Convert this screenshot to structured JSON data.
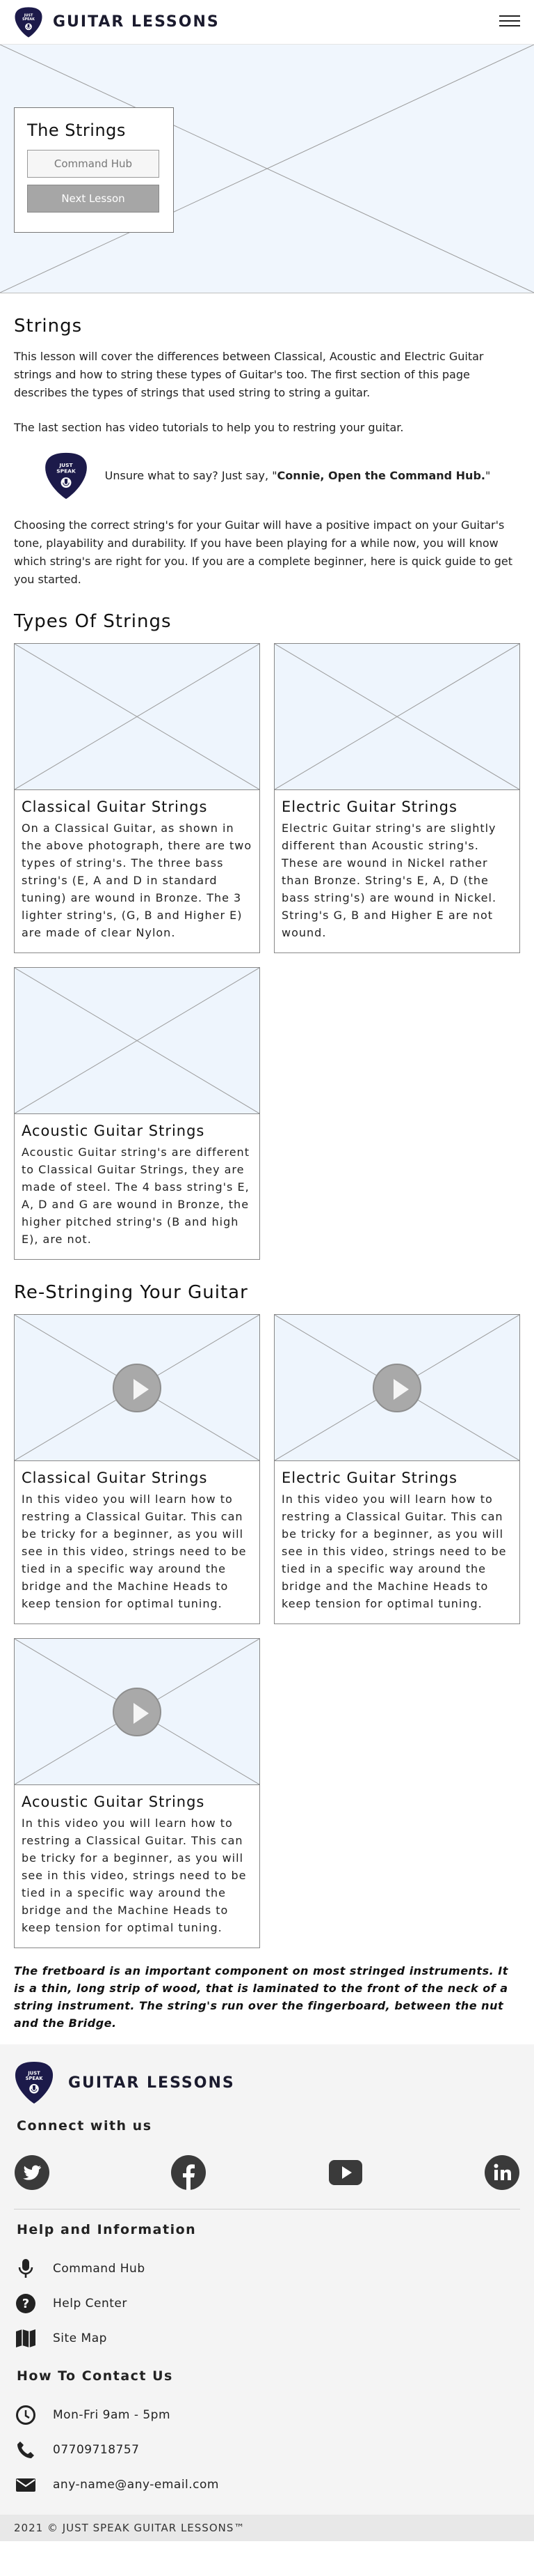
{
  "header": {
    "title": "GUITAR LESSONS",
    "logo_text_1": "JUST",
    "logo_text_2": "SPEAK"
  },
  "hero": {
    "title": "The Strings",
    "primary_button": "Command Hub",
    "secondary_button": "Next Lesson"
  },
  "intro": {
    "heading": "Strings",
    "paragraph_1": "This lesson will cover the differences between Classical, Acoustic and Electric Guitar strings and how to string these types of Guitar's too. The first section of this page describes the types of strings that used string to string a guitar.",
    "paragraph_2": "The last section has video tutorials to help you to restring your guitar.",
    "assist_prefix": "Unsure what to say? Just say, \"",
    "assist_bold": "Connie, Open the Command Hub.",
    "assist_suffix": "\"",
    "paragraph_3": "Choosing the correct string's for your Guitar will have a positive impact on your Guitar's tone, playability and durability. If you have been playing for a while now, you will know which string's are right for you. If you are a complete beginner, here is quick guide to get you started."
  },
  "types": {
    "heading": "Types Of Strings",
    "cards": [
      {
        "title": "Classical Guitar Strings",
        "text": "On a Classical Guitar, as shown in the above photograph, there are two types of string's. The three bass string's (E, A and D in standard tuning) are wound in Bronze. The 3 lighter string's, (G, B and Higher E) are made of clear Nylon."
      },
      {
        "title": "Electric Guitar Strings",
        "text": "Electric Guitar string's are slightly different than Acoustic string's. These are wound in Nickel rather than Bronze. String's E, A, D (the bass string's) are wound in Nickel. String's G, B and Higher E are not wound."
      },
      {
        "title": "Acoustic Guitar Strings",
        "text": "Acoustic Guitar string's are different to Classical Guitar Strings, they are made of steel. The 4 bass string's E, A, D and G are wound in Bronze, the higher pitched string's (B and high E), are not."
      }
    ]
  },
  "restring": {
    "heading": "Re-Stringing Your Guitar",
    "cards": [
      {
        "title": "Classical Guitar Strings",
        "text": "In this video you will learn how to restring a Classical Guitar. This can be tricky for a beginner, as you will see in this video, strings need to be tied in a specific way around the bridge and the Machine Heads to keep tension for optimal tuning."
      },
      {
        "title": "Electric Guitar Strings",
        "text": "In this video you will learn how to restring a Classical Guitar. This can be tricky for a beginner, as you will see in this video, strings need to be tied in a specific way around the bridge and the Machine Heads to keep tension for optimal tuning."
      },
      {
        "title": "Acoustic Guitar Strings",
        "text": "In this video you will learn how to restring a Classical Guitar. This can be tricky for a beginner, as you will see in this video, strings need to be tied in a specific way around the bridge and the Machine Heads to keep tension for optimal tuning."
      }
    ]
  },
  "footnote": "The fretboard is an important component on most stringed instruments. It is a thin, long strip of wood, that is laminated to the front of the neck of a string instrument. The string's run over the fingerboard, between the nut and the Bridge.",
  "footer": {
    "title": "GUITAR LESSONS",
    "connect_heading": "Connect with us",
    "social_icons": [
      "twitter-icon",
      "facebook-icon",
      "youtube-icon",
      "linkedin-icon"
    ],
    "help_heading": "Help and Information",
    "help_items": [
      "Command Hub",
      "Help Center",
      "Site Map"
    ],
    "contact_heading": "How To Contact Us",
    "contact_hours": "Mon-Fri 9am - 5pm",
    "contact_phone": "07709718757",
    "contact_email": "any-name@any-email.com",
    "copyright": "2021 © JUST SPEAK GUITAR LESSONS™"
  },
  "colors": {
    "brand_navy": "#1c1a4a",
    "placeholder_fill": "#eef5fd",
    "button_grey": "#a6a6a6"
  }
}
